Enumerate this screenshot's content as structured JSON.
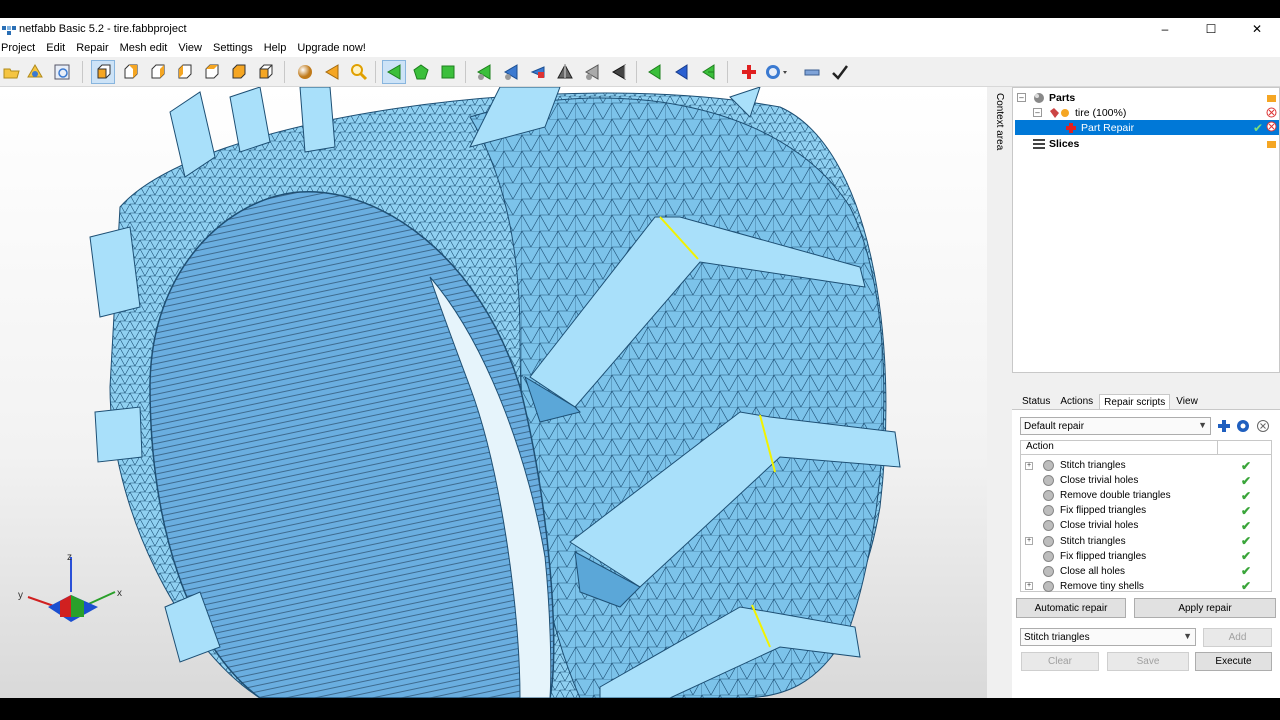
{
  "window": {
    "title": "netfabb Basic 5.2 - tire.fabbproject",
    "controls": [
      "–",
      "☐",
      "✕"
    ]
  },
  "menu": [
    "Project",
    "Edit",
    "Repair",
    "Mesh edit",
    "View",
    "Settings",
    "Help",
    "Upgrade now!"
  ],
  "toolbar_icons": [
    "open-icon",
    "new-part-icon",
    "info-icon",
    "view-front-icon",
    "view-back-icon",
    "view-left-icon",
    "view-right-icon",
    "view-top-icon",
    "view-bottom-icon",
    "view-iso-icon",
    "shading-icon",
    "cut-icon",
    "zoom-icon",
    "select-triangle-icon",
    "select-surface-icon",
    "select-shell-icon",
    "add-triangle-icon",
    "remove-triangle-icon",
    "flip-triangle-icon",
    "triangle-view-icon",
    "invert-icon",
    "wire-icon",
    "move-green-icon",
    "move-blue-icon",
    "move-green-2-icon",
    "repair-icon",
    "measure-icon",
    "minus-icon",
    "check-icon"
  ],
  "context_area_label": "Context area",
  "tree": {
    "parts_label": "Parts",
    "part_label": "tire (100%)",
    "repair_label": "Part Repair",
    "slices_label": "Slices"
  },
  "tabs": [
    "Status",
    "Actions",
    "Repair scripts",
    "View"
  ],
  "active_tab": "Repair scripts",
  "script_select": "Default repair",
  "action_header": "Action",
  "actions": [
    {
      "label": "Stitch triangles",
      "expandable": true
    },
    {
      "label": "Close trivial holes",
      "expandable": false
    },
    {
      "label": "Remove double triangles",
      "expandable": false
    },
    {
      "label": "Fix flipped triangles",
      "expandable": false
    },
    {
      "label": "Close trivial holes",
      "expandable": false
    },
    {
      "label": "Stitch triangles",
      "expandable": true
    },
    {
      "label": "Fix flipped triangles",
      "expandable": false
    },
    {
      "label": "Close all holes",
      "expandable": false
    },
    {
      "label": "Remove tiny shells",
      "expandable": true
    }
  ],
  "add_select": "Stitch triangles",
  "buttons": {
    "add": "Add",
    "clear": "Clear",
    "save": "Save",
    "execute": "Execute",
    "automatic_repair": "Automatic repair",
    "apply_repair": "Apply repair"
  },
  "axis": {
    "x": "x",
    "y": "y",
    "z": "z"
  },
  "colors": {
    "mesh_fill": "#9ad8f6",
    "mesh_shadow": "#5ba7d8",
    "selection": "#0078d7",
    "check": "#3aa53a",
    "highlight_edge": "#f2f200"
  }
}
